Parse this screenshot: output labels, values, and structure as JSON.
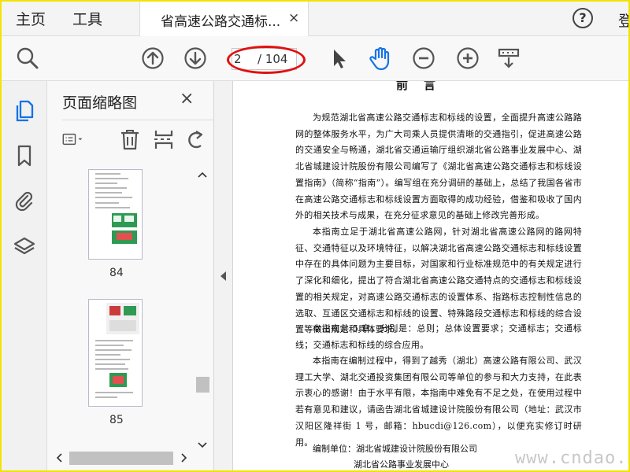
{
  "tabs": {
    "home_label": "主页",
    "tools_label": "工具",
    "doc_title": "省高速公路交通标...",
    "close_glyph": "×",
    "help_glyph": "?",
    "signin_label": "登"
  },
  "toolbar": {
    "current_page": "2",
    "total_pages": "/ 104",
    "icons": [
      "zoom-search-icon",
      "page-up-icon",
      "page-down-icon",
      "select-pointer-icon",
      "hand-tool-icon",
      "zoom-out-icon",
      "zoom-in-icon",
      "page-display-icon"
    ],
    "accent": "#1473e6",
    "highlight_ring": "#e01010"
  },
  "rail": {
    "icons": [
      "page-thumbnails-icon",
      "bookmarks-icon",
      "attachments-icon",
      "layers-icon"
    ]
  },
  "panel": {
    "title": "页面缩略图",
    "close_glyph": "×",
    "tool_icons": [
      "thumbnail-options-icon",
      "delete-page-icon",
      "extract-page-icon",
      "rotate-page-icon"
    ],
    "thumbnails": [
      {
        "page_number": "84"
      },
      {
        "page_number": "85"
      }
    ]
  },
  "document": {
    "heading": "前言",
    "paragraphs": [
      "为规范湖北省高速公路交通标志和标线的设置，全面提升高速公路路网的整体服务水平，为广大司乘人员提供清晰的交通指引，促进高速公路的交通安全与畅通，湖北省交通运输厅组织湖北省公路事业发展中心、湖北省城建设计院股份有限公司编写了《湖北省高速公路交通标志和标线设置指南》（简称“指南”）。编写组在充分调研的基础上，总结了我国各省市在高速公路交通标志和标线设置方面取得的成功经验，借鉴和吸收了国内外的相关技术与成果，在充分征求意见的基础上修改完善形成。",
      "本指南立足于湖北省高速公路网，针对湖北省高速公路网的路网特征、交通特征以及环境特征，以解决湖北省高速公路交通标志和标线设置中存在的具体问题为主要目标，对国家和行业标准规范中的有关规定进行了深化和细化，提出了符合湖北省高速公路交通特点的交通标志和标线设置的相关规定，对高速公路交通标志的设置体系、指路标志控制性信息的选取、互通区交通标志和标线的设置、特殊路段交通标志和标线的综合设置等做出规定和具体要求。",
      "本指南共 5 章，分别是：总则；总体设置要求；交通标志；交通标线；交通标志和标线的综合应用。",
      "本指南在编制过程中，得到了越秀（湖北）高速公路有限公司、武汉理工大学、湖北交通投资集团有限公司等单位的参与和大力支持，在此表示衷心的感谢！由于水平有限，本指南中难免有不足之处，在使用过程中若有意见和建议，请函告湖北省城建设计院股份有限公司（地址：武汉市汉阳区隆祥街 1 号，邮箱：hbucdi@126.com），以便充实修订时研用。"
    ],
    "compiler_label": "编制单位：湖北省城建设计院股份有限公司",
    "compiler_line2": "湖北省公路事业发展中心"
  },
  "watermark": "www.cndao.com"
}
